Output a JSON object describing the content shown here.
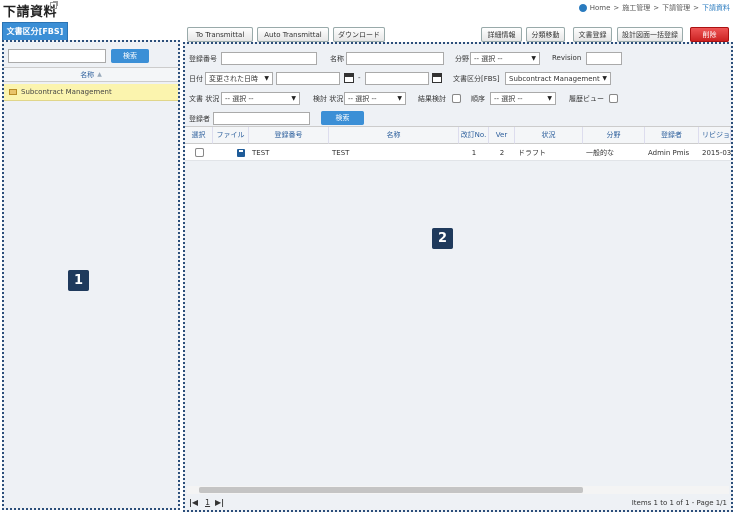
{
  "header": {
    "title": "下請資料",
    "breadcrumb": [
      "Home",
      "施工管理",
      "下請管理",
      "下請資料"
    ],
    "breadcrumb_sep": ">"
  },
  "left": {
    "tab_label": "文書区分[FBS]",
    "search_button": "検索",
    "column_header": "名称",
    "tree_items": [
      "Subcontract Management"
    ],
    "badge": "1"
  },
  "toolbar": {
    "to_transmittal": "To Transmittal",
    "auto_transmittal": "Auto Transmittal",
    "download": "ダウンロード",
    "details": "詳細情報",
    "category_move": "分類移動",
    "doc_register": "文書登録",
    "bulk_register": "設計図面一括登録",
    "delete": "削除"
  },
  "search": {
    "reg_no_label": "登録番号",
    "name_label": "名称",
    "field_label": "分野",
    "field_value": "-- 選択 --",
    "revision_label": "Revision",
    "date_label": "日付",
    "date_type_value": "変更された日時",
    "date_sep": "-",
    "doc_class_label": "文書区分[FBS]",
    "doc_class_value": "Subcontract Management",
    "doc_status_label": "文書 状況",
    "doc_status_value": "-- 選択 --",
    "review_status_label": "検討 状況",
    "review_status_value": "-- 選択 --",
    "result_review_label": "結果検討",
    "order_label": "順序",
    "order_value": "-- 選択 --",
    "history_view_label": "履歴ビュー",
    "registrant_label": "登録者",
    "search_button": "検索"
  },
  "grid": {
    "columns": [
      "選択",
      "ファイル",
      "登録番号",
      "名称",
      "改訂No.",
      "Ver",
      "状況",
      "分野",
      "登録者",
      "リビジョン"
    ],
    "rows": [
      {
        "reg_no": "TEST",
        "name": "TEST",
        "rev_no": "1",
        "ver": "2",
        "status": "ドラフト",
        "field": "一般的な",
        "registrant": "Admin Pmis",
        "revision_date": "2015-03"
      }
    ]
  },
  "pager": {
    "first": "|◀",
    "page": "1",
    "last": "▶|",
    "summary": "Items 1 to 1 of 1 - Page 1/1"
  },
  "right": {
    "badge": "2"
  }
}
